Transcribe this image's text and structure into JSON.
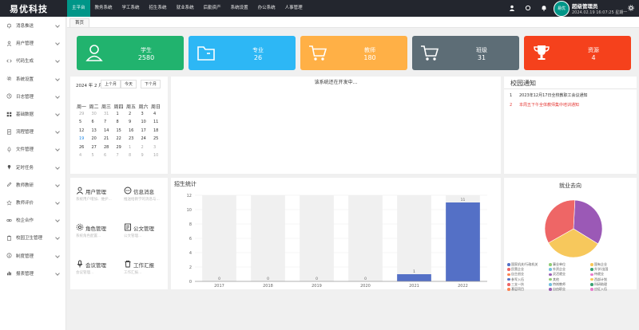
{
  "app": {
    "logo": "易优科技",
    "user_name": "超级管理员",
    "user_time": "2024.02.19 16:07:25 星期一",
    "avatar_text": "易优"
  },
  "topnav": [
    {
      "label": "主平台",
      "active": true
    },
    {
      "label": "教务系统"
    },
    {
      "label": "学工系统"
    },
    {
      "label": "招生系统"
    },
    {
      "label": "就业系统"
    },
    {
      "label": "后勤资产"
    },
    {
      "label": "系统设置"
    },
    {
      "label": "办公系统"
    },
    {
      "label": "人事管理"
    }
  ],
  "top_icons": [
    "user-icon",
    "refresh-icon",
    "bell-icon",
    "gear-icon"
  ],
  "sidebar": [
    {
      "label": "消息推送",
      "icon": "bell-icon"
    },
    {
      "label": "用户管理",
      "icon": "user-icon"
    },
    {
      "label": "代码生成",
      "icon": "code-icon"
    },
    {
      "label": "系统设置",
      "icon": "gear-icon"
    },
    {
      "label": "日志管理",
      "icon": "clock-icon"
    },
    {
      "label": "基础数据",
      "icon": "grid-icon"
    },
    {
      "label": "流程管理",
      "icon": "doc-icon"
    },
    {
      "label": "文件管理",
      "icon": "rocket-icon"
    },
    {
      "label": "定时任务",
      "icon": "pin-icon"
    },
    {
      "label": "教师教研",
      "icon": "edit-icon"
    },
    {
      "label": "教师评价",
      "icon": "star-icon"
    },
    {
      "label": "校企合作",
      "icon": "link-icon"
    },
    {
      "label": "校园卫生管理",
      "icon": "clipboard-icon"
    },
    {
      "label": "制度管理",
      "icon": "info-icon"
    },
    {
      "label": "报表管理",
      "icon": "chart-icon"
    }
  ],
  "tabs": {
    "home": "首页"
  },
  "stats": [
    {
      "label": "学生",
      "value": "2580",
      "color": "#21b36e",
      "icon": "user-icon"
    },
    {
      "label": "专业",
      "value": "26",
      "color": "#2db7f5",
      "icon": "folder-icon"
    },
    {
      "label": "教师",
      "value": "180",
      "color": "#ffb046",
      "icon": "cart-icon"
    },
    {
      "label": "班级",
      "value": "31",
      "color": "#5d6d76",
      "icon": "cart-icon"
    },
    {
      "label": "资源",
      "value": "4",
      "color": "#f5411c",
      "icon": "trophy-icon"
    }
  ],
  "calendar": {
    "month": "2024 年 2 月",
    "buttons": [
      "上个月",
      "今天",
      "下个月"
    ],
    "weekdays": [
      "周一",
      "周二",
      "周三",
      "周四",
      "周五",
      "周六",
      "周日"
    ],
    "rows": [
      [
        "29",
        "30",
        "31",
        "1",
        "2",
        "3",
        "4"
      ],
      [
        "5",
        "6",
        "7",
        "8",
        "9",
        "10",
        "11"
      ],
      [
        "12",
        "13",
        "14",
        "15",
        "16",
        "17",
        "18"
      ],
      [
        "19",
        "20",
        "21",
        "22",
        "23",
        "24",
        "25"
      ],
      [
        "26",
        "27",
        "28",
        "29",
        "1",
        "2",
        "3"
      ],
      [
        "4",
        "5",
        "6",
        "7",
        "8",
        "9",
        "10"
      ]
    ],
    "today": "19"
  },
  "placeholder": {
    "text": "该系统还在开发中..."
  },
  "notice": {
    "title": "校园通知",
    "items": [
      {
        "num": "1",
        "text": "2023年12月17日全校教职工会议通知",
        "color": "#333"
      },
      {
        "num": "2",
        "text": "本周五下午全体教师集中培训通知",
        "color": "#e53935"
      }
    ]
  },
  "functions": [
    {
      "title": "用户管理",
      "desc": "系统用户增加、维护...",
      "icon": "user-icon"
    },
    {
      "title": "信息消息",
      "desc": "推送给教学的消息与...",
      "icon": "chat-icon"
    },
    {
      "title": "角色管理",
      "desc": "系统角色配置...",
      "icon": "gear-icon"
    },
    {
      "title": "公文管理",
      "desc": "公文管理...",
      "icon": "doc-icon"
    },
    {
      "title": "会议管理",
      "desc": "会议管理...",
      "icon": "mic-icon"
    },
    {
      "title": "工作汇报",
      "desc": "工作汇报...",
      "icon": "trash-icon"
    }
  ],
  "chart_data": [
    {
      "type": "bar",
      "title": "招生统计",
      "categories": [
        "2017",
        "2018",
        "2019",
        "2020",
        "2021",
        "2022"
      ],
      "values": [
        0,
        0,
        0,
        0,
        1,
        11
      ],
      "ylim": [
        0,
        12
      ],
      "yticks": [
        0,
        2,
        4,
        6,
        8,
        10,
        12
      ],
      "bar_color": "#5470c6",
      "background_bar_color": "#f0f0f0"
    },
    {
      "type": "pie",
      "title": "就业去向",
      "series": [
        {
          "values": [
            33,
            33,
            34
          ]
        }
      ],
      "slice_colors": [
        "#9b59b6",
        "#f7c85c",
        "#ee6666"
      ],
      "legend": [
        {
          "name": "国家机关/行政机关",
          "color": "#5470c6"
        },
        {
          "name": "事业单位",
          "color": "#91cc75"
        },
        {
          "name": "国有企业",
          "color": "#fac858"
        },
        {
          "name": "民营企业",
          "color": "#ee6666"
        },
        {
          "name": "外资企业",
          "color": "#73c0de"
        },
        {
          "name": "升学/出国",
          "color": "#3ba272"
        },
        {
          "name": "自主创业",
          "color": "#fc8452"
        },
        {
          "name": "灵活就业",
          "color": "#9a60b4"
        },
        {
          "name": "待就业",
          "color": "#ea7ccc"
        },
        {
          "name": "参军入伍",
          "color": "#5470c6"
        },
        {
          "name": "其他",
          "color": "#91cc75"
        },
        {
          "name": "西部计划",
          "color": "#fac858"
        },
        {
          "name": "三支一扶",
          "color": "#ee6666"
        },
        {
          "name": "特岗教师",
          "color": "#73c0de"
        },
        {
          "name": "科研助理",
          "color": "#3ba272"
        },
        {
          "name": "基层项目",
          "color": "#fc8452"
        },
        {
          "name": "自由职业",
          "color": "#9a60b4"
        },
        {
          "name": "应征入伍",
          "color": "#ea7ccc"
        }
      ]
    }
  ]
}
